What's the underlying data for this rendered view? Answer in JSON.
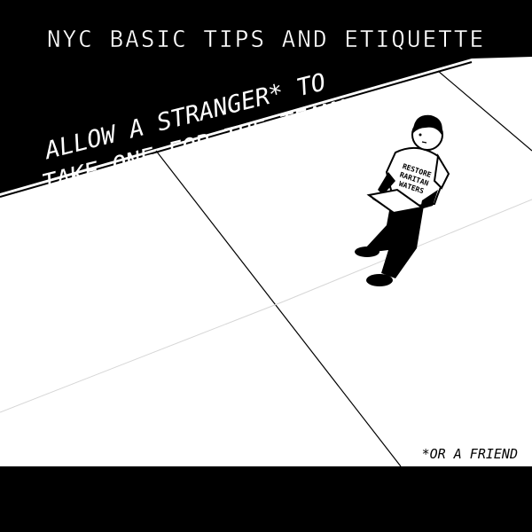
{
  "comic": {
    "title": "NYC BASIC TIPS AND ETIQUETTE",
    "caption_line1": "ALLOW A STRANGER* TO",
    "caption_line2": "TAKE ONE FOR THE TEAM!",
    "footnote": "*OR A FRIEND",
    "shirt_line1": "RESTORE",
    "shirt_line2": "RARITAN",
    "shirt_line3": "WATERS"
  },
  "colors": {
    "background": "#000000",
    "sidewalk": "#ffffff",
    "ink": "#000000",
    "text_on_dark": "#ffffff",
    "pavement_line": "#000000",
    "faint_line": "#dddddd"
  }
}
